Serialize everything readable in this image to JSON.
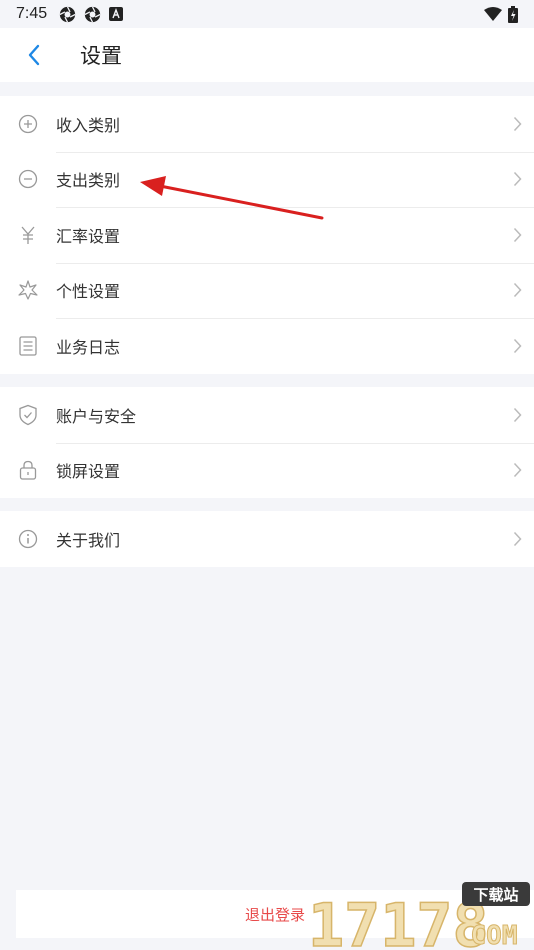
{
  "status": {
    "time": "7:45"
  },
  "header": {
    "title": "设置",
    "back_icon": "chevron-left-icon"
  },
  "groups": [
    {
      "items": [
        {
          "label": "收入类别",
          "icon": "plus-circle-icon"
        },
        {
          "label": "支出类别",
          "icon": "minus-circle-icon"
        },
        {
          "label": "汇率设置",
          "icon": "yen-icon"
        },
        {
          "label": "个性设置",
          "icon": "sparkle-icon"
        },
        {
          "label": "业务日志",
          "icon": "list-icon"
        }
      ]
    },
    {
      "items": [
        {
          "label": "账户与安全",
          "icon": "shield-check-icon"
        },
        {
          "label": "锁屏设置",
          "icon": "lock-icon"
        }
      ]
    },
    {
      "items": [
        {
          "label": "关于我们",
          "icon": "info-icon"
        }
      ]
    }
  ],
  "footer": {
    "logout_label": "退出登录"
  },
  "watermark": {
    "digits": "17178",
    "tag": "下载站",
    "domain": "COM"
  },
  "colors": {
    "accent": "#1e88e5",
    "danger": "#e84a4a",
    "arrow": "#d9201f"
  }
}
